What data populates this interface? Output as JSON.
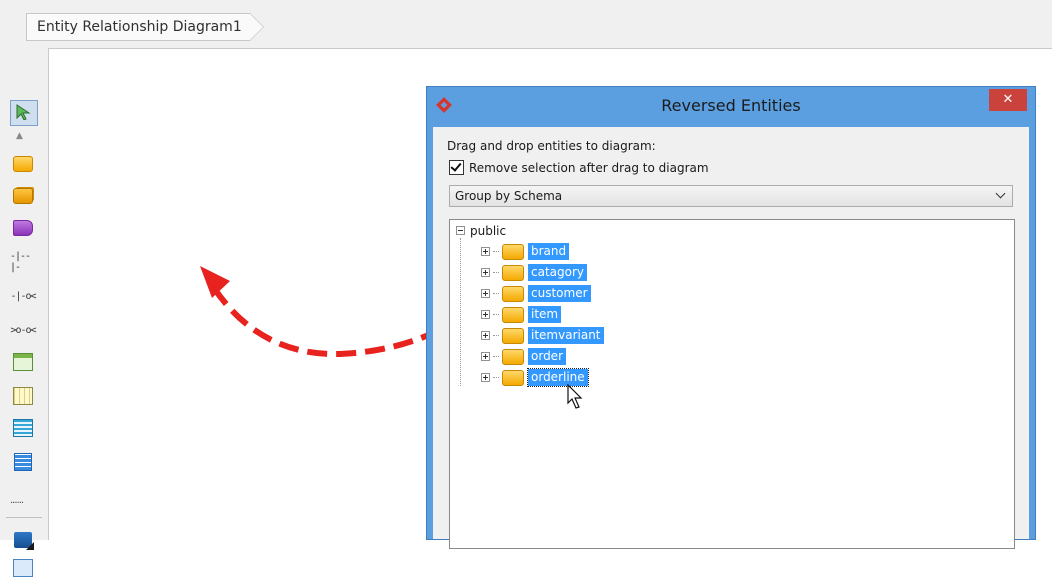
{
  "breadcrumb": {
    "diagram_name": "Entity Relationship Diagram1"
  },
  "palette": {
    "tools": [
      {
        "name": "selection-tool-icon"
      },
      {
        "name": "entity-tool-icon"
      },
      {
        "name": "entity-alt-tool-icon"
      },
      {
        "name": "view-tool-icon"
      },
      {
        "name": "one-to-one-relationship-icon"
      },
      {
        "name": "one-to-many-relationship-icon"
      },
      {
        "name": "many-to-many-relationship-icon"
      },
      {
        "name": "table-tool-icon"
      },
      {
        "name": "grid-tool-icon"
      },
      {
        "name": "list-tool-icon"
      },
      {
        "name": "document-tool-icon"
      },
      {
        "name": "folder-tool-icon"
      },
      {
        "name": "package-tool-icon"
      }
    ],
    "rel_labels": {
      "one_to_one": "-|--|-",
      "one_to_many": "-|-o<",
      "many_to_many": ">o-o<",
      "dots": "......"
    }
  },
  "dialog": {
    "title": "Reversed Entities",
    "close_label": "✕",
    "drag_label": "Drag and drop entities to diagram:",
    "remove_selection": {
      "label": "Remove selection after drag to diagram",
      "checked": true
    },
    "group_by": {
      "selected": "Group by Schema"
    },
    "tree": {
      "schema": "public",
      "entities": [
        "brand",
        "catagory",
        "customer",
        "item",
        "itemvariant",
        "order",
        "orderline"
      ],
      "focused": "orderline"
    }
  },
  "colors": {
    "selection": "#3399ff",
    "dialog_frame": "#5b9fe0",
    "close_button": "#c9423c",
    "arrow": "#e8231f"
  }
}
